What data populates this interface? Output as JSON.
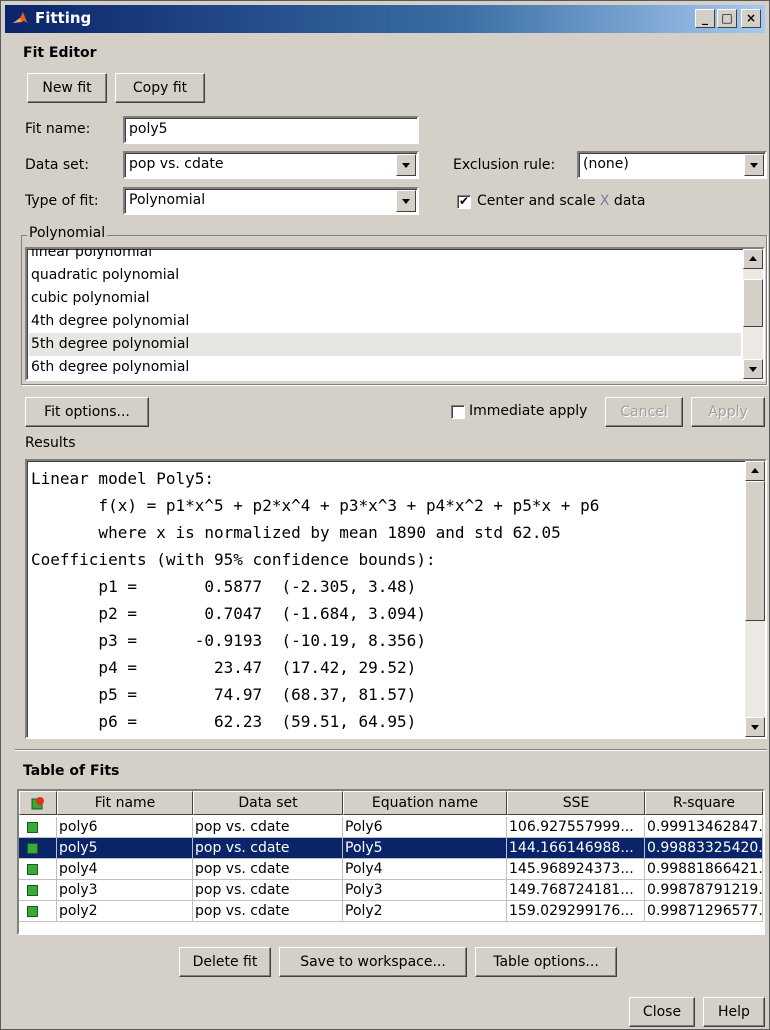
{
  "window": {
    "title": "Fitting"
  },
  "fit_editor": {
    "heading": "Fit Editor",
    "new_fit": "New fit",
    "copy_fit": "Copy fit",
    "fit_name_label": "Fit name:",
    "fit_name_value": "poly5",
    "data_set_label": "Data set:",
    "data_set_value": "pop vs. cdate",
    "exclusion_label": "Exclusion rule:",
    "exclusion_value": "(none)",
    "type_label": "Type of fit:",
    "type_value": "Polynomial",
    "center_scale_pre": "Center and scale ",
    "center_scale_x": "X",
    "center_scale_post": " data",
    "center_scale_checked": true
  },
  "polynomial": {
    "group_label": "Polynomial",
    "items": [
      "linear polynomial",
      "quadratic polynomial",
      "cubic polynomial",
      "4th degree polynomial",
      "5th degree polynomial",
      "6th degree polynomial"
    ],
    "selected": "5th degree polynomial"
  },
  "options_row": {
    "fit_options": "Fit options...",
    "immediate_apply": "Immediate apply",
    "cancel": "Cancel",
    "apply": "Apply"
  },
  "results": {
    "label": "Results",
    "lines": [
      "Linear model Poly5:",
      "       f(x) = p1*x^5 + p2*x^4 + p3*x^3 + p4*x^2 + p5*x + p6",
      "       where x is normalized by mean 1890 and std 62.05",
      "Coefficients (with 95% confidence bounds):",
      "       p1 =       0.5877  (-2.305, 3.48)",
      "       p2 =       0.7047  (-1.684, 3.094)",
      "       p3 =      -0.9193  (-10.19, 8.356)",
      "       p4 =        23.47  (17.42, 29.52)",
      "       p5 =        74.97  (68.37, 81.57)",
      "       p6 =        62.23  (59.51, 64.95)"
    ]
  },
  "table_of_fits": {
    "heading": "Table of Fits",
    "columns": [
      "Fit name",
      "Data set",
      "Equation name",
      "SSE",
      "R-square"
    ],
    "rows": [
      {
        "name": "poly6",
        "data_set": "pop vs. cdate",
        "equation": "Poly6",
        "sse": "106.927557999...",
        "rsq": "0.99913462847..."
      },
      {
        "name": "poly5",
        "data_set": "pop vs. cdate",
        "equation": "Poly5",
        "sse": "144.166146988...",
        "rsq": "0.99883325420..."
      },
      {
        "name": "poly4",
        "data_set": "pop vs. cdate",
        "equation": "Poly4",
        "sse": "145.968924373...",
        "rsq": "0.99881866421..."
      },
      {
        "name": "poly3",
        "data_set": "pop vs. cdate",
        "equation": "Poly3",
        "sse": "149.768724181...",
        "rsq": "0.99878791219..."
      },
      {
        "name": "poly2",
        "data_set": "pop vs. cdate",
        "equation": "Poly2",
        "sse": "159.029299176...",
        "rsq": "0.99871296577..."
      }
    ],
    "selected_row": "poly5"
  },
  "bottom_buttons": {
    "delete_fit": "Delete fit",
    "save_workspace": "Save to workspace...",
    "table_options": "Table options...",
    "close": "Close",
    "help": "Help"
  },
  "colors": {
    "titlebar": "#0a246a",
    "selection": "#0a246a",
    "fit_icon": "#3aa83a"
  }
}
